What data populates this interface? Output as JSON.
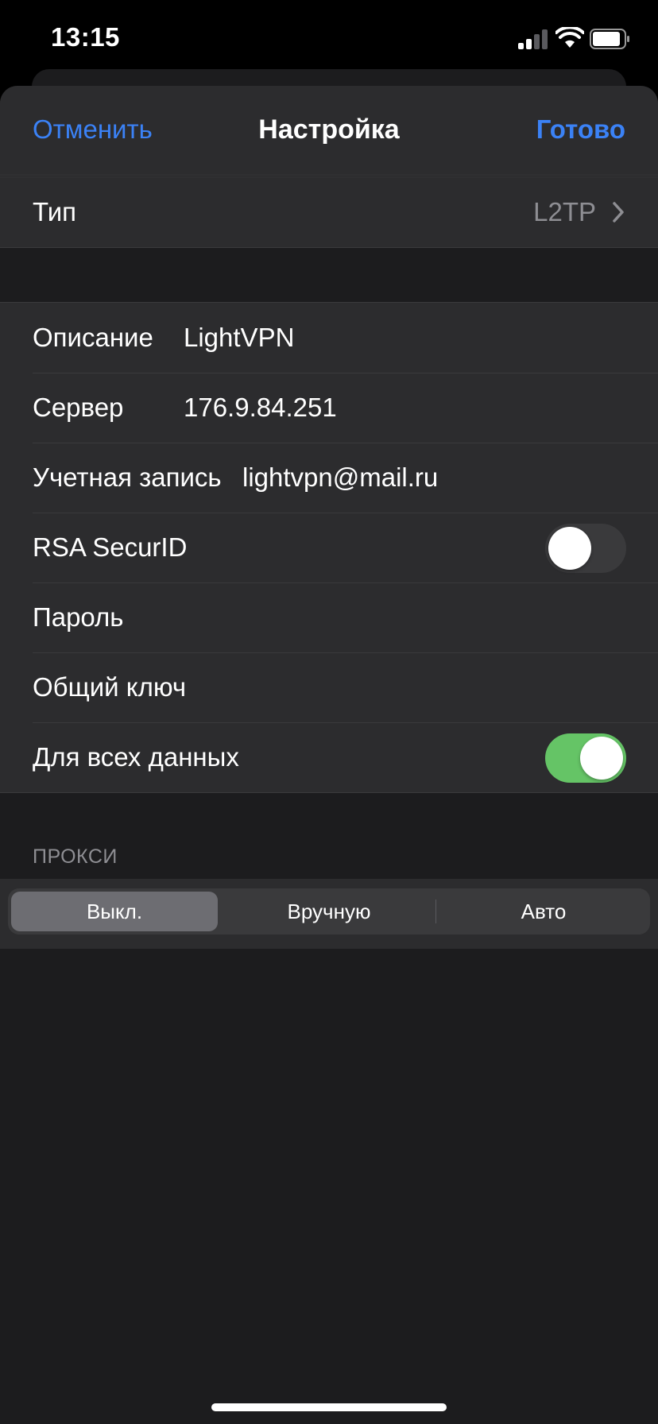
{
  "status_bar": {
    "time": "13:15",
    "signal_bars": 2,
    "battery_level": 0.85
  },
  "nav": {
    "cancel_label": "Отменить",
    "title": "Настройка",
    "done_label": "Готово"
  },
  "type_row": {
    "label": "Тип",
    "value": "L2TP"
  },
  "settings": {
    "description": {
      "label": "Описание",
      "value": "LightVPN"
    },
    "server": {
      "label": "Сервер",
      "value": "176.9.84.251"
    },
    "account": {
      "label": "Учетная запись",
      "value": "lightvpn@mail.ru"
    },
    "rsa": {
      "label": "RSA SecurID",
      "on": false
    },
    "password": {
      "label": "Пароль",
      "value": ""
    },
    "shared_key": {
      "label": "Общий ключ",
      "value": ""
    },
    "send_all": {
      "label": "Для всех данных",
      "on": true
    }
  },
  "proxy": {
    "header": "ПРОКСИ",
    "options": [
      "Выкл.",
      "Вручную",
      "Авто"
    ],
    "selected": "Выкл."
  },
  "colors": {
    "accent": "#3b82f6",
    "toggle_on": "#65c466",
    "background": "#1c1c1e",
    "cell": "#2c2c2e"
  }
}
